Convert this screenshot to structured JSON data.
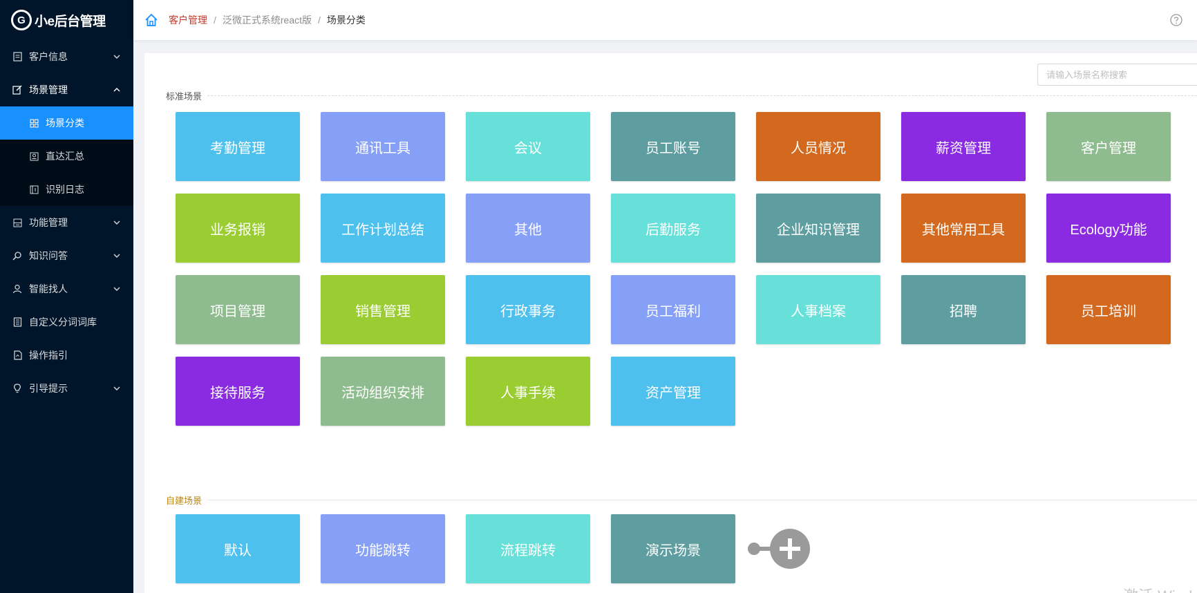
{
  "app": {
    "logo_mark": "G",
    "title": "小e后台管理"
  },
  "sidebar": {
    "items": [
      {
        "label": "客户信息",
        "icon": "file-icon",
        "expanded": false
      },
      {
        "label": "场景管理",
        "icon": "edit-icon",
        "expanded": true
      },
      {
        "label": "功能管理",
        "icon": "app-icon",
        "expanded": false
      },
      {
        "label": "知识问答",
        "icon": "search-icon",
        "expanded": false
      },
      {
        "label": "智能找人",
        "icon": "user-icon",
        "expanded": false
      },
      {
        "label": "自定义分词词库",
        "icon": "book-icon"
      },
      {
        "label": "操作指引",
        "icon": "guide-icon"
      },
      {
        "label": "引导提示",
        "icon": "bulb-icon",
        "expanded": false
      }
    ],
    "submenu": [
      {
        "label": "场景分类",
        "icon": "grid-icon",
        "active": true
      },
      {
        "label": "直达汇总",
        "icon": "summary-icon"
      },
      {
        "label": "识别日志",
        "icon": "log-icon"
      }
    ]
  },
  "header": {
    "breadcrumb": [
      "客户管理",
      "泛微正式系统react版",
      "场景分类"
    ]
  },
  "search": {
    "placeholder": "请输入场景名称搜索"
  },
  "sections": {
    "standard_title": "标准场景",
    "custom_title": "自建场景"
  },
  "standard_tiles": [
    {
      "label": "考勤管理",
      "color": "#4dc0ee"
    },
    {
      "label": "通讯工具",
      "color": "#86a0f8"
    },
    {
      "label": "会议",
      "color": "#66e0d8"
    },
    {
      "label": "员工账号",
      "color": "#5f9ea0"
    },
    {
      "label": "人员情况",
      "color": "#d2691e"
    },
    {
      "label": "薪资管理",
      "color": "#8a2be2"
    },
    {
      "label": "客户管理",
      "color": "#8fbc8f"
    },
    {
      "label": "业务报销",
      "color": "#9acd32"
    },
    {
      "label": "工作计划总结",
      "color": "#4dc0ee"
    },
    {
      "label": "其他",
      "color": "#86a0f8"
    },
    {
      "label": "后勤服务",
      "color": "#66e0d8"
    },
    {
      "label": "企业知识管理",
      "color": "#5f9ea0"
    },
    {
      "label": "其他常用工具",
      "color": "#d2691e"
    },
    {
      "label": "Ecology功能",
      "color": "#8a2be2"
    },
    {
      "label": "项目管理",
      "color": "#8fbc8f"
    },
    {
      "label": "销售管理",
      "color": "#9acd32"
    },
    {
      "label": "行政事务",
      "color": "#4dc0ee"
    },
    {
      "label": "员工福利",
      "color": "#86a0f8"
    },
    {
      "label": "人事档案",
      "color": "#66e0d8"
    },
    {
      "label": "招聘",
      "color": "#5f9ea0"
    },
    {
      "label": "员工培训",
      "color": "#d2691e"
    },
    {
      "label": "接待服务",
      "color": "#8a2be2"
    },
    {
      "label": "活动组织安排",
      "color": "#8fbc8f"
    },
    {
      "label": "人事手续",
      "color": "#9acd32"
    },
    {
      "label": "资产管理",
      "color": "#4dc0ee"
    }
  ],
  "custom_tiles": [
    {
      "label": "默认",
      "color": "#4dc0ee"
    },
    {
      "label": "功能跳转",
      "color": "#86a0f8"
    },
    {
      "label": "流程跳转",
      "color": "#66e0d8"
    },
    {
      "label": "演示场景",
      "color": "#5f9ea0"
    }
  ],
  "watermark": "激活 Windows"
}
